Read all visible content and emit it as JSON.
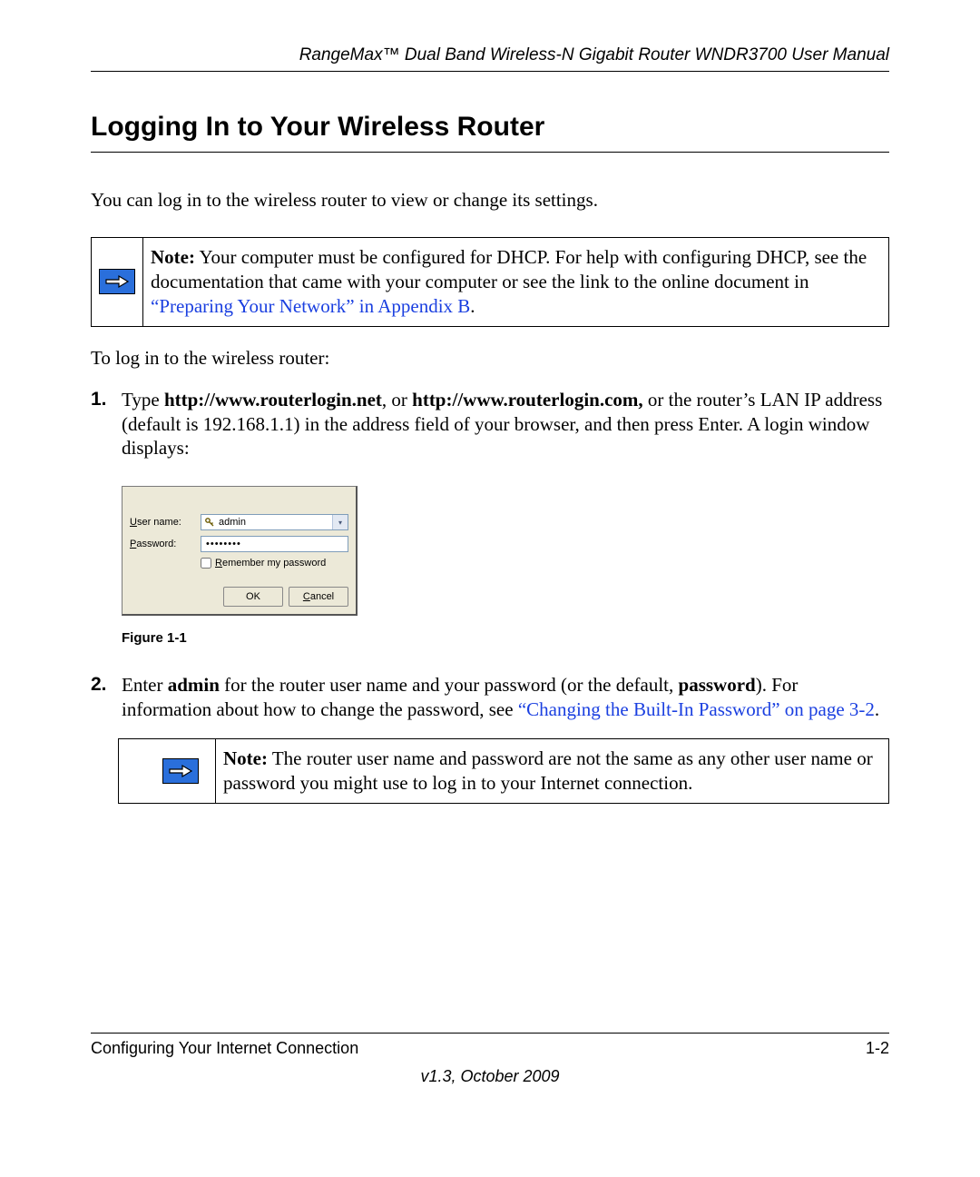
{
  "header": {
    "title": "RangeMax™ Dual Band Wireless-N Gigabit Router WNDR3700 User Manual"
  },
  "section": {
    "title": "Logging In to Your Wireless Router",
    "intro": "You can log in to the wireless router to view or change its settings."
  },
  "note1": {
    "prefix": "Note:",
    "line1": " Your computer must be configured for DHCP. For help with configuring DHCP, see the documentation that came with your computer or see the link to the online document in ",
    "link": "“Preparing Your Network” in Appendix B",
    "after": "."
  },
  "lead": "To log in to the wireless router:",
  "steps": {
    "s1": {
      "num": "1.",
      "t1": "Type ",
      "b1": "http://www.routerlogin.net",
      "t2": ", or ",
      "b2": "http://www.routerlogin.com,",
      "t3": " or the router’s LAN IP address (default is 192.168.1.1) in the address field of your browser, and then press Enter. A login window displays:"
    },
    "s2": {
      "num": "2.",
      "t1": "Enter ",
      "b1": "admin",
      "t2": " for the router user name and your password (or the default, ",
      "b2": "password",
      "t3": "). For information about how to change the password, see ",
      "link": "“Changing the Built-In Password” on page 3-2",
      "after": "."
    }
  },
  "login_dialog": {
    "user_label_u": "U",
    "user_label_rest": "ser name:",
    "pass_label_u": "P",
    "pass_label_rest": "assword:",
    "user_value": "admin",
    "pass_value": "••••••••",
    "remember_u": "R",
    "remember_rest": "emember my password",
    "ok": "OK",
    "cancel_u": "C",
    "cancel_rest": "ancel",
    "figure_caption": "Figure 1-1"
  },
  "note2": {
    "prefix": "Note:",
    "body": " The router user name and password are not the same as any other user name or password you might use to log in to your Internet connection."
  },
  "footer": {
    "section": "Configuring Your Internet Connection",
    "page": "1-2",
    "version": "v1.3, October 2009"
  }
}
